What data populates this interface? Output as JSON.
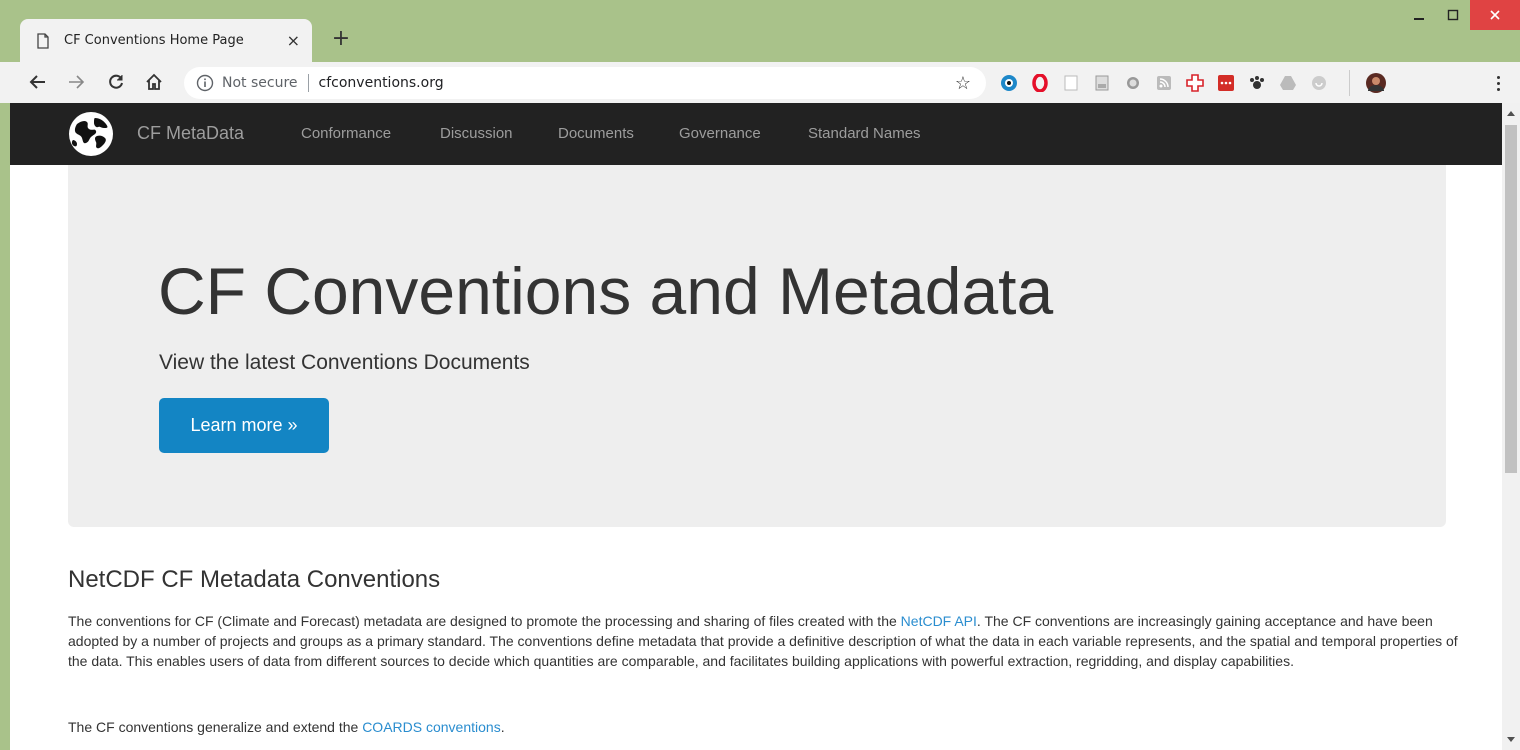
{
  "browser": {
    "tab": {
      "title": "CF Conventions Home Page",
      "close_glyph": "×"
    },
    "new_tab_glyph": "+",
    "window": {
      "minimize": "–",
      "maximize": "□",
      "close": "✕"
    },
    "address": {
      "security_label": "Not secure",
      "url": "cfconventions.org"
    },
    "colors": {
      "frame": "#a9c28a",
      "close_button": "#e04343"
    }
  },
  "site_nav": {
    "brand": "CF MetaData",
    "links": [
      "Conformance",
      "Discussion",
      "Documents",
      "Governance",
      "Standard Names"
    ]
  },
  "hero": {
    "title": "CF Conventions and Metadata",
    "subtitle": "View the latest Conventions Documents",
    "button_label": "Learn more »",
    "button_color": "#1385c4"
  },
  "content": {
    "section_title": "NetCDF CF Metadata Conventions",
    "para1_before": "The conventions for CF (Climate and Forecast) metadata are designed to promote the processing and sharing of files created with the ",
    "para1_link": "NetCDF API",
    "para1_after": ". The CF conventions are increasingly gaining acceptance and have been adopted by a number of projects and groups as a primary standard. The conventions define metadata that provide a definitive description of what the data in each variable represents, and the spatial and temporal properties of the data. This enables users of data from different sources to decide which quantities are comparable, and facilitates building applications with powerful extraction, regridding, and display capabilities.",
    "para2_before": "The CF conventions generalize and extend the ",
    "para2_link": "COARDS conventions",
    "para2_after": ".",
    "link_color": "#2a8dcf"
  }
}
